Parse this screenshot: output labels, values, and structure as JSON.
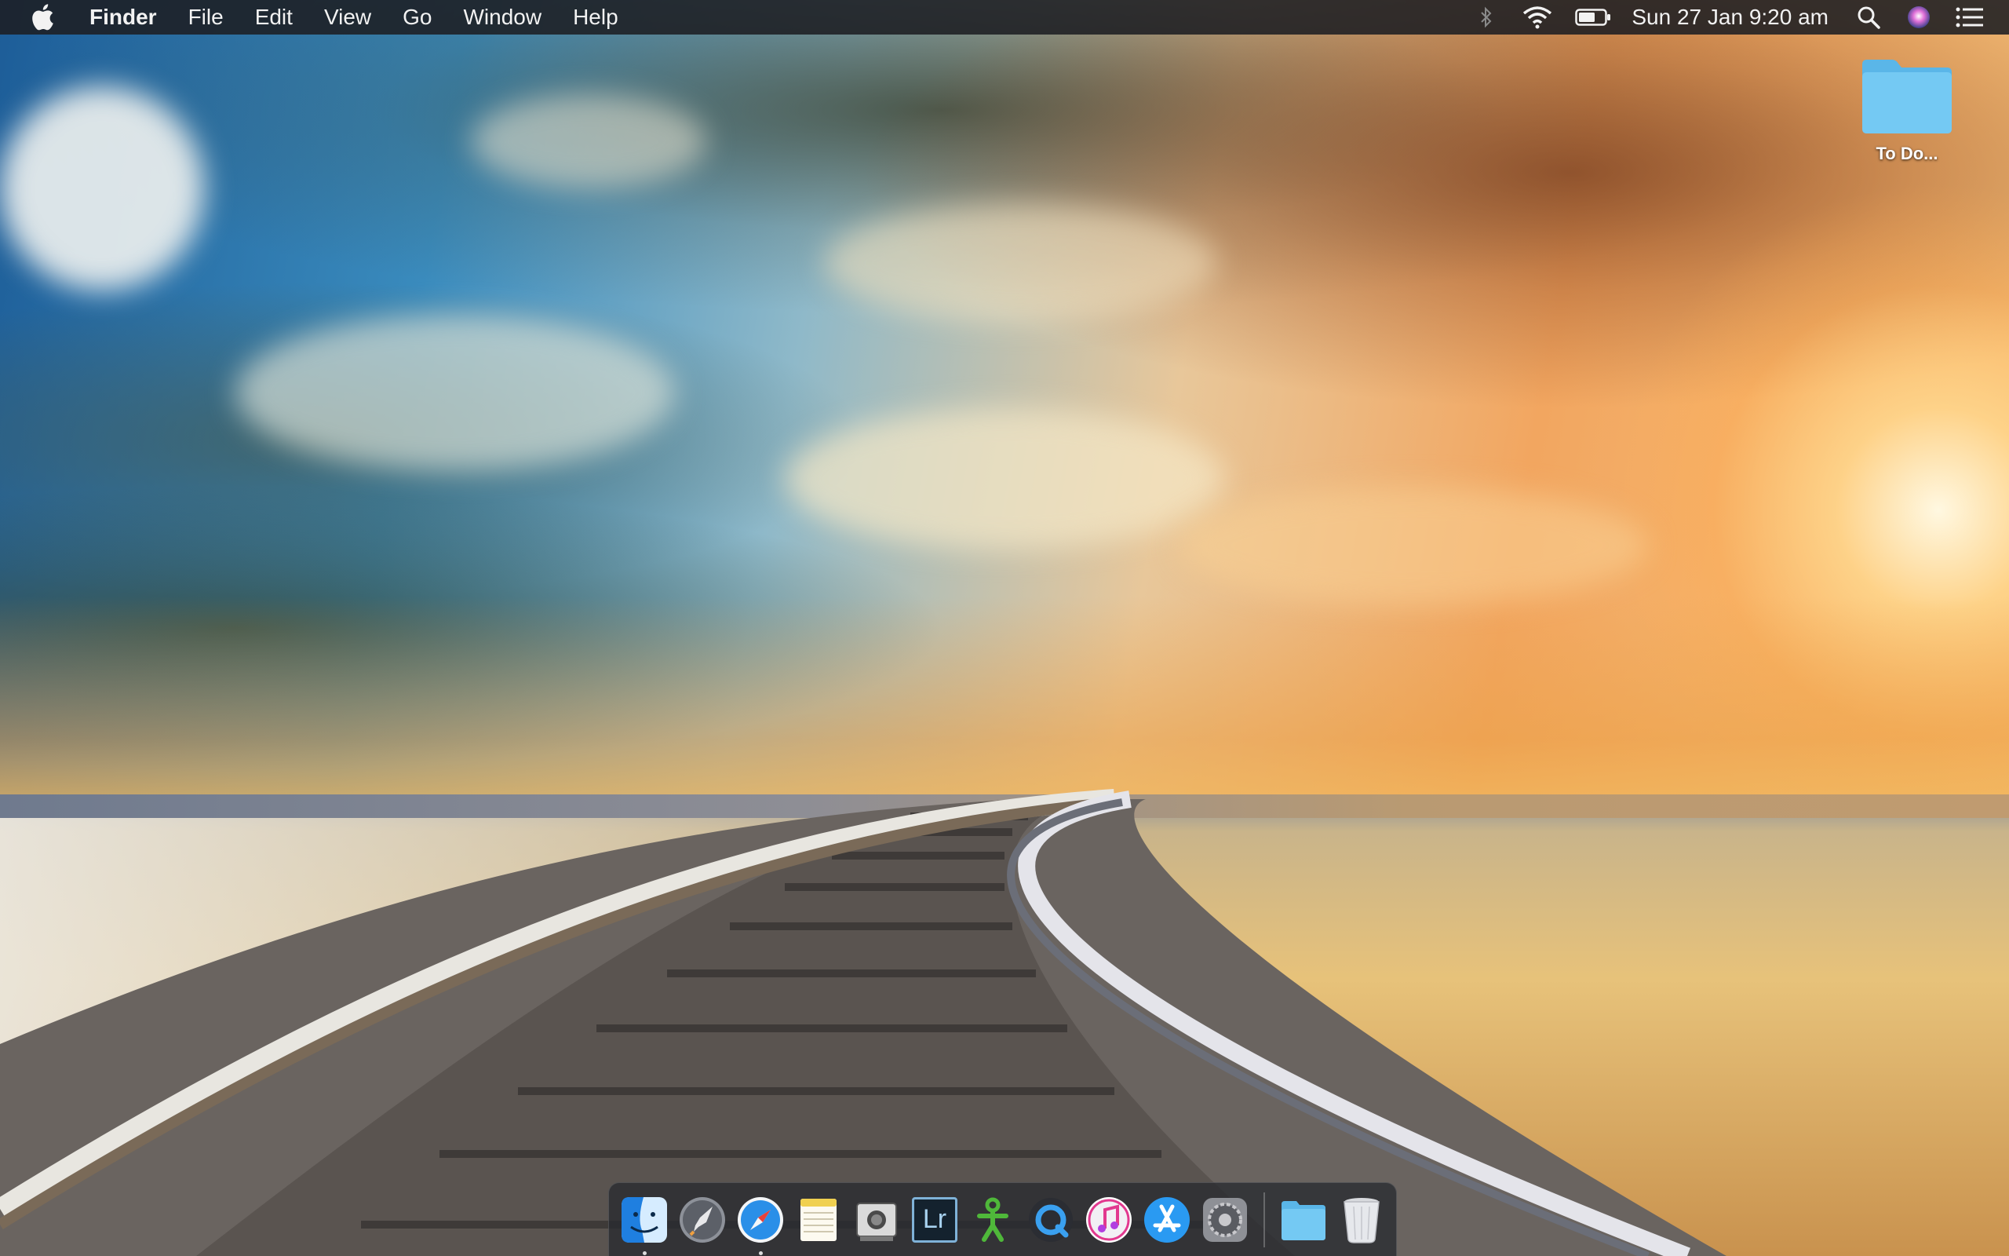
{
  "menubar": {
    "apple_icon": "apple-logo-icon",
    "app_name": "Finder",
    "menus": [
      "File",
      "Edit",
      "View",
      "Go",
      "Window",
      "Help"
    ],
    "status_icons": [
      "bluetooth-icon",
      "wifi-icon",
      "battery-icon"
    ],
    "clock": "Sun 27 Jan  9:20 am",
    "right_icons": [
      "spotlight-search-icon",
      "siri-icon",
      "notification-center-icon"
    ]
  },
  "desktop": {
    "folders": [
      {
        "label": "To Do...",
        "icon": "folder-icon"
      }
    ]
  },
  "dock": {
    "apps": [
      {
        "name": "Finder",
        "icon": "finder-icon",
        "running": true
      },
      {
        "name": "Launchpad",
        "icon": "launchpad-icon",
        "running": false
      },
      {
        "name": "Safari",
        "icon": "safari-icon",
        "running": true
      },
      {
        "name": "Notes",
        "icon": "notes-icon",
        "running": false
      },
      {
        "name": "Screenshot Utility",
        "icon": "screenshot-utility-icon",
        "running": false
      },
      {
        "name": "Lightroom",
        "icon": "lightroom-icon",
        "label": "Lr",
        "running": false
      },
      {
        "name": "Xcode Accessibility",
        "icon": "green-figure-icon",
        "running": false
      },
      {
        "name": "QuickTime Player",
        "icon": "quicktime-icon",
        "running": false
      },
      {
        "name": "iTunes",
        "icon": "itunes-icon",
        "running": false
      },
      {
        "name": "App Store",
        "icon": "app-store-icon",
        "running": false
      },
      {
        "name": "System Preferences",
        "icon": "system-preferences-icon",
        "running": false
      }
    ],
    "others": [
      {
        "name": "Downloads",
        "icon": "downloads-folder-icon"
      },
      {
        "name": "Trash",
        "icon": "trash-icon"
      }
    ]
  },
  "colors": {
    "menubar_bg": "#1c1e22",
    "folder_blue": "#6cc4f0",
    "sky_blue": "#1d5d98",
    "sunset_orange": "#f2a660"
  }
}
